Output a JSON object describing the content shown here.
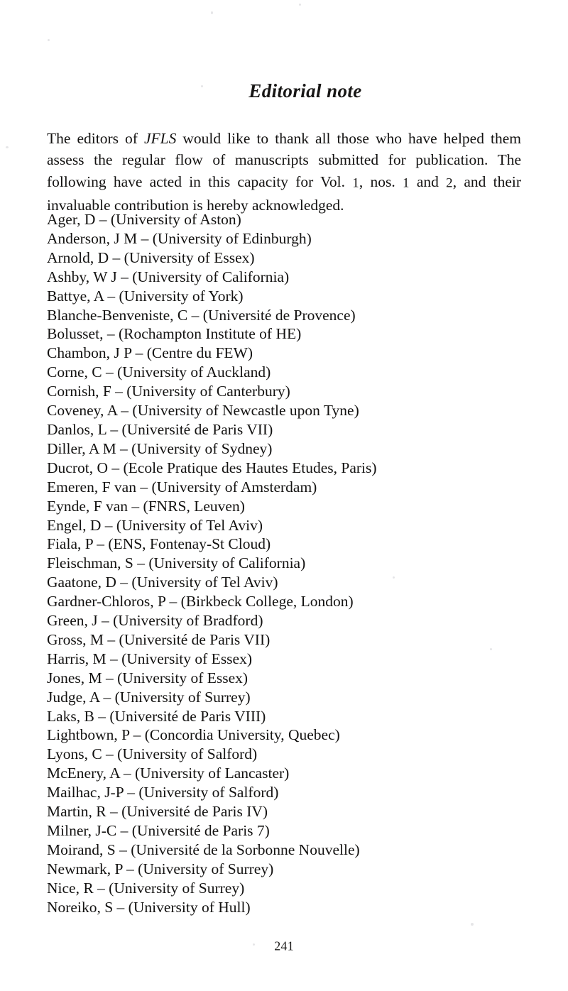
{
  "document": {
    "title": "Editorial note",
    "folio": "241",
    "intro": {
      "before_italic": "The editors of ",
      "italic_term": "JFLS",
      "after_italic": " would like to thank all those who have helped them assess the regular flow of manuscripts submitted for publication. The following have acted in this capacity for Vol. 1, nos. 1 and 2, and their invaluable contribution is hereby acknowledged."
    },
    "contributors": [
      "Ager, D – (University of Aston)",
      "Anderson, J M – (University of Edinburgh)",
      "Arnold, D – (University of Essex)",
      "Ashby, W J – (University of California)",
      "Battye, A – (University of York)",
      "Blanche-Benveniste, C – (Université de Provence)",
      "Bolusset, – (Rochampton Institute of HE)",
      "Chambon, J P – (Centre du FEW)",
      "Corne, C – (University of Auckland)",
      "Cornish, F – (University of Canterbury)",
      "Coveney, A – (University of Newcastle upon Tyne)",
      "Danlos, L – (Université de Paris VII)",
      "Diller, A M – (University of Sydney)",
      "Ducrot, O – (Ecole Pratique des Hautes Etudes, Paris)",
      "Emeren, F van – (University of Amsterdam)",
      "Eynde, F van – (FNRS, Leuven)",
      "Engel, D – (University of Tel Aviv)",
      "Fiala, P – (ENS, Fontenay-St Cloud)",
      "Fleischman, S – (University of California)",
      "Gaatone, D – (University of Tel Aviv)",
      "Gardner-Chloros, P – (Birkbeck College, London)",
      "Green, J – (University of Bradford)",
      "Gross, M – (Université de Paris VII)",
      "Harris, M – (University of Essex)",
      "Jones, M – (University of Essex)",
      "Judge, A – (University of Surrey)",
      "Laks, B – (Université de Paris VIII)",
      "Lightbown, P – (Concordia University, Quebec)",
      "Lyons, C – (University of Salford)",
      "McEnery, A – (University of Lancaster)",
      "Mailhac, J-P – (University of Salford)",
      "Martin, R – (Université de Paris IV)",
      "Milner, J-C – (Université de Paris 7)",
      "Moirand, S – (Université de la Sorbonne Nouvelle)",
      "Newmark, P – (University of Surrey)",
      "Nice, R – (University of Surrey)",
      "Noreiko, S – (University of Hull)"
    ]
  }
}
